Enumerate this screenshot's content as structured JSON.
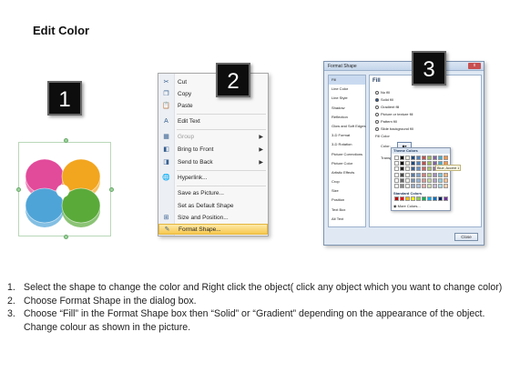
{
  "title": "Edit Color",
  "steps": {
    "one": "1",
    "two": "2",
    "three": "3"
  },
  "shape": {
    "petal_colors": [
      "#e24a9a",
      "#f2a51e",
      "#4fa4d7",
      "#5aaa3a"
    ]
  },
  "context_menu": {
    "items": [
      {
        "label": "Cut",
        "icon": "scissors-icon",
        "disabled": false,
        "submenu": false
      },
      {
        "label": "Copy",
        "icon": "copy-icon",
        "disabled": false,
        "submenu": false
      },
      {
        "label": "Paste",
        "icon": "paste-icon",
        "disabled": false,
        "submenu": false
      },
      {
        "label": "Edit Text",
        "icon": "edit-text-icon",
        "disabled": false,
        "submenu": false
      },
      {
        "label": "Group",
        "icon": "group-icon",
        "disabled": true,
        "submenu": true
      },
      {
        "label": "Bring to Front",
        "icon": "bring-front-icon",
        "disabled": false,
        "submenu": true
      },
      {
        "label": "Send to Back",
        "icon": "send-back-icon",
        "disabled": false,
        "submenu": true
      },
      {
        "label": "Hyperlink...",
        "icon": "hyperlink-icon",
        "disabled": false,
        "submenu": false
      },
      {
        "label": "Save as Picture...",
        "icon": "",
        "disabled": false,
        "submenu": false
      },
      {
        "label": "Set as Default Shape",
        "icon": "",
        "disabled": false,
        "submenu": false
      },
      {
        "label": "Size and Position...",
        "icon": "size-position-icon",
        "disabled": false,
        "submenu": false
      },
      {
        "label": "Format Shape...",
        "icon": "format-shape-icon",
        "disabled": false,
        "submenu": false,
        "highlighted": true
      }
    ]
  },
  "dialog": {
    "title": "Format Shape",
    "close_label": "x",
    "categories": [
      "Fill",
      "Line Color",
      "Line Style",
      "Shadow",
      "Reflection",
      "Glow and Soft Edges",
      "3-D Format",
      "3-D Rotation",
      "Picture Corrections",
      "Picture Color",
      "Artistic Effects",
      "Crop",
      "Size",
      "Position",
      "Text Box",
      "Alt Text"
    ],
    "selected_category": "Fill",
    "fill_heading": "Fill",
    "fill_options": [
      "No fill",
      "Solid fill",
      "Gradient fill",
      "Picture or texture fill",
      "Pattern fill",
      "Slide background fill"
    ],
    "selected_fill": "Solid fill",
    "fill_color_label": "Fill Color",
    "color_label": "Color:",
    "transparency_label": "Transpa",
    "close_button": "Close"
  },
  "palette": {
    "theme_label": "Theme Colors",
    "standard_label": "Standard Colors",
    "more_label": "More Colors...",
    "tooltip": "Blue, Accent 1",
    "theme_top": [
      "#ffffff",
      "#000000",
      "#eeece1",
      "#1f497d",
      "#4f81bd",
      "#c0504d",
      "#9bbb59",
      "#8064a2",
      "#4bacc6",
      "#f79646"
    ],
    "standard": [
      "#c00000",
      "#ff0000",
      "#ffc000",
      "#ffff00",
      "#92d050",
      "#00b050",
      "#00b0f0",
      "#0070c0",
      "#002060",
      "#7030a0"
    ]
  },
  "instructions": [
    {
      "num": "1.",
      "text": "Select the shape to change the color and Right click the object( click any object which you want to change color)"
    },
    {
      "num": "2.",
      "text": "Choose Format Shape in the dialog box."
    },
    {
      "num": "3.",
      "text": "Choose “Fill” in the Format Shape box then “Solid” or “Gradient” depending on the appearance of the object. Change colour as shown in the picture."
    }
  ]
}
